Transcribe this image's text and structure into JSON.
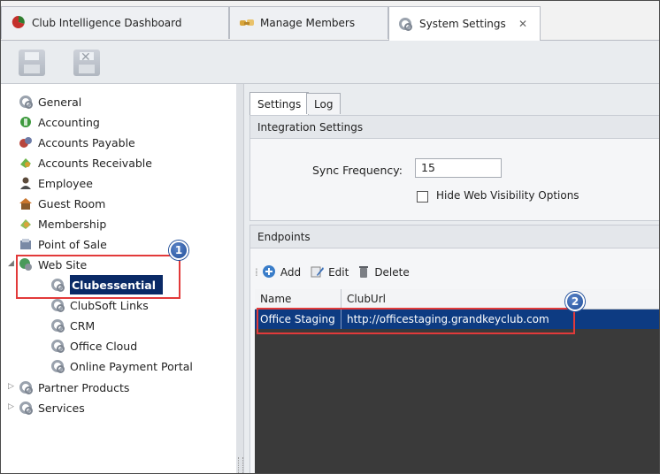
{
  "tabs": [
    {
      "label": "Club Intelligence Dashboard",
      "icon": "pie-chart-icon",
      "active": false
    },
    {
      "label": "Manage Members",
      "icon": "handshake-icon",
      "active": false
    },
    {
      "label": "System Settings",
      "icon": "gears-icon",
      "active": true,
      "close": "✕"
    }
  ],
  "toolbar": {
    "buttons": [
      "save-icon",
      "save-close-icon"
    ]
  },
  "tree": {
    "items": [
      {
        "label": "General",
        "icon": "gears-icon"
      },
      {
        "label": "Accounting",
        "icon": "accounting-icon"
      },
      {
        "label": "Accounts Payable",
        "icon": "accounts-payable-icon"
      },
      {
        "label": "Accounts Receivable",
        "icon": "accounts-receivable-icon"
      },
      {
        "label": "Employee",
        "icon": "employee-icon"
      },
      {
        "label": "Guest Room",
        "icon": "guest-room-icon"
      },
      {
        "label": "Membership",
        "icon": "membership-icon"
      },
      {
        "label": "Point of Sale",
        "icon": "point-of-sale-icon"
      },
      {
        "label": "Web Site",
        "icon": "globe-gear-icon"
      },
      {
        "label": "Clubessential",
        "icon": "gears-icon"
      },
      {
        "label": "ClubSoft Links",
        "icon": "gears-icon"
      },
      {
        "label": "CRM",
        "icon": "gears-icon"
      },
      {
        "label": "Office Cloud",
        "icon": "gears-icon"
      },
      {
        "label": "Online Payment Portal",
        "icon": "gears-icon"
      },
      {
        "label": "Partner Products",
        "icon": "gears-icon"
      },
      {
        "label": "Services",
        "icon": "gears-icon"
      }
    ]
  },
  "settings": {
    "tabs": [
      "Settings",
      "Log"
    ],
    "integration_header": "Integration Settings",
    "sync_label": "Sync Frequency:",
    "sync_value": "15",
    "hide_checkbox_label": "Hide Web Visibility Options",
    "hide_checked": false,
    "endpoints_header": "Endpoints",
    "grid_toolbar": {
      "add": "Add",
      "edit": "Edit",
      "delete": "Delete"
    },
    "grid": {
      "columns": [
        "Name",
        "ClubUrl"
      ],
      "rows": [
        [
          "Office Staging",
          "http://officestaging.grandkeyclub.com"
        ]
      ]
    }
  },
  "callouts": [
    "1",
    "2"
  ],
  "colors": {
    "selection": "#0a2a66",
    "callout_red": "#e23a3a",
    "badge_blue": "#1f4d99"
  }
}
